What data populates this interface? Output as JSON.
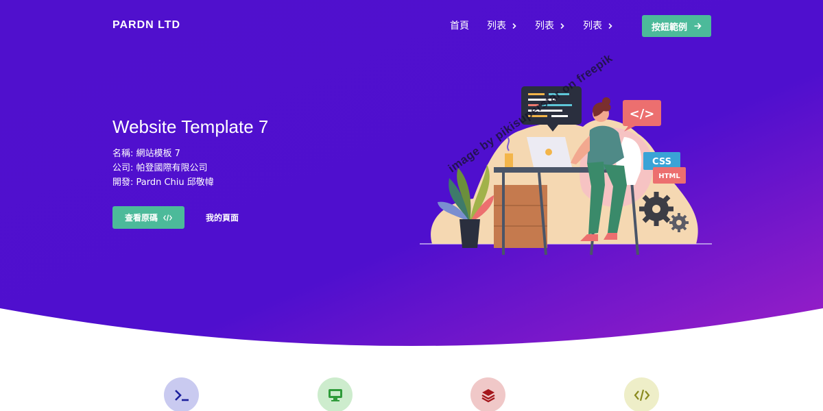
{
  "brand": "PARDN LTD",
  "nav": {
    "items": [
      {
        "label": "首頁",
        "has_chevron": false
      },
      {
        "label": "列表",
        "has_chevron": true
      },
      {
        "label": "列表",
        "has_chevron": true
      },
      {
        "label": "列表",
        "has_chevron": true
      }
    ],
    "cta_label": "按鈕範例"
  },
  "hero": {
    "title": "Website Template 7",
    "info": {
      "name": "名稱: 網站模板 7",
      "company": "公司: 帕登國際有限公司",
      "developer": "開發: Pardn Chiu 邱敬幃"
    },
    "primary_button": "查看原碼",
    "secondary_button": "我的頁面",
    "watermark": "image by pikisuperstar on freepik",
    "illustration": {
      "css_label": "CSS",
      "html_label": "HTML",
      "code_label": "</>"
    }
  },
  "features": [
    {
      "icon": "terminal-icon",
      "color": "#1b1f9c",
      "bg": "#c9caf0"
    },
    {
      "icon": "monitor-icon",
      "color": "#2f9b3a",
      "bg": "#cdeccd"
    },
    {
      "icon": "layers-icon",
      "color": "#a4161b",
      "bg": "#f0c8c8"
    },
    {
      "icon": "code-icon",
      "color": "#8a8a1e",
      "bg": "#eeeec8"
    }
  ],
  "colors": {
    "hero_start": "#4f0ccd",
    "hero_end": "#8a1bcb",
    "accent": "#4cba9a"
  }
}
